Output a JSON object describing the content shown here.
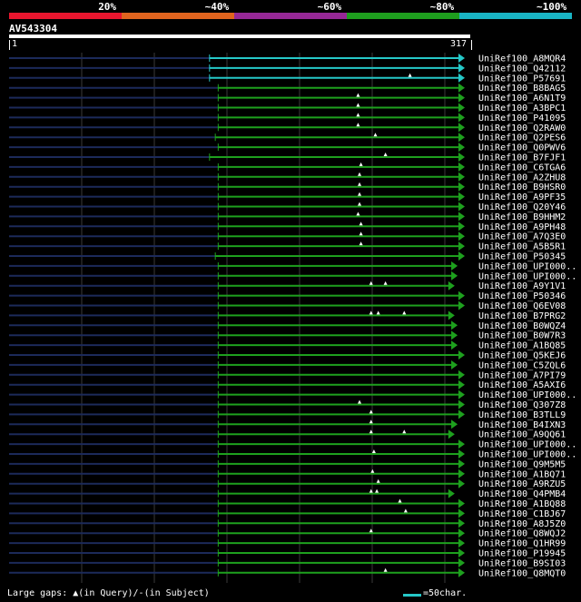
{
  "identity_scale": {
    "segments": [
      {
        "label": "20%",
        "color": "#e8162e"
      },
      {
        "label": "~40%",
        "color": "#e0641e"
      },
      {
        "label": "~60%",
        "color": "#962896"
      },
      {
        "label": "~80%",
        "color": "#1e9e1e"
      },
      {
        "label": "~100%",
        "color": "#19b4c4"
      }
    ]
  },
  "query": {
    "id": "AV543304",
    "start": "1",
    "end": "317",
    "length": 317
  },
  "colors": {
    "high": "#25c8c8",
    "mid": "#1ea01e",
    "background_line": "#1c2a5a",
    "marker": "#ffffff",
    "grid": "#3a3a3a"
  },
  "hits": [
    {
      "label": "UniRef100_A8MQR4",
      "start": 140,
      "end": 317,
      "cls": "high",
      "markers": []
    },
    {
      "label": "UniRef100_Q42112",
      "start": 140,
      "end": 317,
      "cls": "high",
      "markers": []
    },
    {
      "label": "UniRef100_P57691",
      "start": 140,
      "end": 317,
      "cls": "high",
      "markers": [
        279
      ]
    },
    {
      "label": "UniRef100_B8BAG5",
      "start": 146,
      "end": 317,
      "cls": "mid",
      "markers": []
    },
    {
      "label": "UniRef100_A6N1T9",
      "start": 146,
      "end": 317,
      "cls": "mid",
      "markers": [
        243
      ]
    },
    {
      "label": "UniRef100_A3BPC1",
      "start": 146,
      "end": 317,
      "cls": "mid",
      "markers": [
        243
      ]
    },
    {
      "label": "UniRef100_P41095",
      "start": 146,
      "end": 317,
      "cls": "mid",
      "markers": [
        243
      ]
    },
    {
      "label": "UniRef100_Q2RAW0",
      "start": 146,
      "end": 317,
      "cls": "mid",
      "markers": [
        243
      ]
    },
    {
      "label": "UniRef100_Q2PES6",
      "start": 144,
      "end": 317,
      "cls": "mid",
      "markers": [
        255
      ]
    },
    {
      "label": "UniRef100_Q0PWV6",
      "start": 146,
      "end": 317,
      "cls": "mid",
      "markers": []
    },
    {
      "label": "UniRef100_B7FJF1",
      "start": 140,
      "end": 317,
      "cls": "mid",
      "markers": [
        262
      ]
    },
    {
      "label": "UniRef100_C6TGA6",
      "start": 146,
      "end": 317,
      "cls": "mid",
      "markers": [
        245
      ]
    },
    {
      "label": "UniRef100_A2ZHU8",
      "start": 146,
      "end": 317,
      "cls": "mid",
      "markers": [
        244
      ]
    },
    {
      "label": "UniRef100_B9HSR0",
      "start": 146,
      "end": 317,
      "cls": "mid",
      "markers": [
        244
      ]
    },
    {
      "label": "UniRef100_A9PF35",
      "start": 146,
      "end": 317,
      "cls": "mid",
      "markers": [
        244
      ]
    },
    {
      "label": "UniRef100_Q20Y46",
      "start": 146,
      "end": 317,
      "cls": "mid",
      "markers": [
        244
      ]
    },
    {
      "label": "UniRef100_B9HHM2",
      "start": 146,
      "end": 317,
      "cls": "mid",
      "markers": [
        243
      ]
    },
    {
      "label": "UniRef100_A9PH48",
      "start": 146,
      "end": 317,
      "cls": "mid",
      "markers": [
        245
      ]
    },
    {
      "label": "UniRef100_A7Q3E0",
      "start": 146,
      "end": 317,
      "cls": "mid",
      "markers": [
        245
      ]
    },
    {
      "label": "UniRef100_A5B5R1",
      "start": 146,
      "end": 317,
      "cls": "mid",
      "markers": [
        245
      ]
    },
    {
      "label": "UniRef100_P50345",
      "start": 144,
      "end": 317,
      "cls": "mid",
      "markers": []
    },
    {
      "label": "UniRef100_UPI000..",
      "start": 146,
      "end": 312,
      "cls": "mid",
      "markers": []
    },
    {
      "label": "UniRef100_UPI000..",
      "start": 146,
      "end": 312,
      "cls": "mid",
      "markers": []
    },
    {
      "label": "UniRef100_A9Y1V1",
      "start": 146,
      "end": 310,
      "cls": "mid",
      "markers": [
        252,
        262
      ]
    },
    {
      "label": "UniRef100_P50346",
      "start": 146,
      "end": 317,
      "cls": "mid",
      "markers": []
    },
    {
      "label": "UniRef100_Q6EV08",
      "start": 146,
      "end": 317,
      "cls": "mid",
      "markers": []
    },
    {
      "label": "UniRef100_B7PRG2",
      "start": 146,
      "end": 310,
      "cls": "mid",
      "markers": [
        252,
        257,
        275
      ]
    },
    {
      "label": "UniRef100_B0WQZ4",
      "start": 146,
      "end": 312,
      "cls": "mid",
      "markers": []
    },
    {
      "label": "UniRef100_B0W7R3",
      "start": 146,
      "end": 312,
      "cls": "mid",
      "markers": []
    },
    {
      "label": "UniRef100_A1BQ85",
      "start": 146,
      "end": 312,
      "cls": "mid",
      "markers": []
    },
    {
      "label": "UniRef100_Q5KEJ6",
      "start": 146,
      "end": 317,
      "cls": "mid",
      "markers": []
    },
    {
      "label": "UniRef100_C5ZQL6",
      "start": 146,
      "end": 312,
      "cls": "mid",
      "markers": []
    },
    {
      "label": "UniRef100_A7PI79",
      "start": 146,
      "end": 317,
      "cls": "mid",
      "markers": []
    },
    {
      "label": "UniRef100_A5AXI6",
      "start": 146,
      "end": 317,
      "cls": "mid",
      "markers": []
    },
    {
      "label": "UniRef100_UPI000..",
      "start": 146,
      "end": 317,
      "cls": "mid",
      "markers": []
    },
    {
      "label": "UniRef100_Q307Z8",
      "start": 146,
      "end": 317,
      "cls": "mid",
      "markers": [
        244
      ]
    },
    {
      "label": "UniRef100_B3TLL9",
      "start": 146,
      "end": 317,
      "cls": "mid",
      "markers": [
        252
      ]
    },
    {
      "label": "UniRef100_B4IXN3",
      "start": 146,
      "end": 312,
      "cls": "mid",
      "markers": [
        252
      ]
    },
    {
      "label": "UniRef100_A9QQ61",
      "start": 146,
      "end": 310,
      "cls": "mid",
      "markers": [
        252,
        275
      ]
    },
    {
      "label": "UniRef100_UPI000..",
      "start": 146,
      "end": 317,
      "cls": "mid",
      "markers": []
    },
    {
      "label": "UniRef100_UPI000..",
      "start": 146,
      "end": 317,
      "cls": "mid",
      "markers": [
        254
      ]
    },
    {
      "label": "UniRef100_Q9M5M5",
      "start": 146,
      "end": 317,
      "cls": "mid",
      "markers": []
    },
    {
      "label": "UniRef100_A1BQ71",
      "start": 146,
      "end": 317,
      "cls": "mid",
      "markers": [
        253
      ]
    },
    {
      "label": "UniRef100_A9RZU5",
      "start": 146,
      "end": 317,
      "cls": "mid",
      "markers": [
        257
      ]
    },
    {
      "label": "UniRef100_Q4PMB4",
      "start": 146,
      "end": 310,
      "cls": "mid",
      "markers": [
        252,
        256
      ]
    },
    {
      "label": "UniRef100_A1BQ88",
      "start": 146,
      "end": 317,
      "cls": "mid",
      "markers": [
        272
      ]
    },
    {
      "label": "UniRef100_C1BJ67",
      "start": 146,
      "end": 317,
      "cls": "mid",
      "markers": [
        276
      ]
    },
    {
      "label": "UniRef100_A8J5Z0",
      "start": 146,
      "end": 317,
      "cls": "mid",
      "markers": []
    },
    {
      "label": "UniRef100_Q8WQJ2",
      "start": 146,
      "end": 317,
      "cls": "mid",
      "markers": [
        252
      ]
    },
    {
      "label": "UniRef100_Q1HR99",
      "start": 146,
      "end": 317,
      "cls": "mid",
      "markers": []
    },
    {
      "label": "UniRef100_P19945",
      "start": 146,
      "end": 317,
      "cls": "mid",
      "markers": []
    },
    {
      "label": "UniRef100_B9SI03",
      "start": 146,
      "end": 317,
      "cls": "mid",
      "markers": []
    },
    {
      "label": "UniRef100_Q8MQT0",
      "start": 146,
      "end": 317,
      "cls": "mid",
      "markers": [
        262
      ]
    }
  ],
  "legend": {
    "prefix": "Large gaps:",
    "query_marker": "▲",
    "query_text": "(in Query)/",
    "subject_marker": "-",
    "subject_text": "(in Subject)",
    "scale_text": "=50char."
  }
}
